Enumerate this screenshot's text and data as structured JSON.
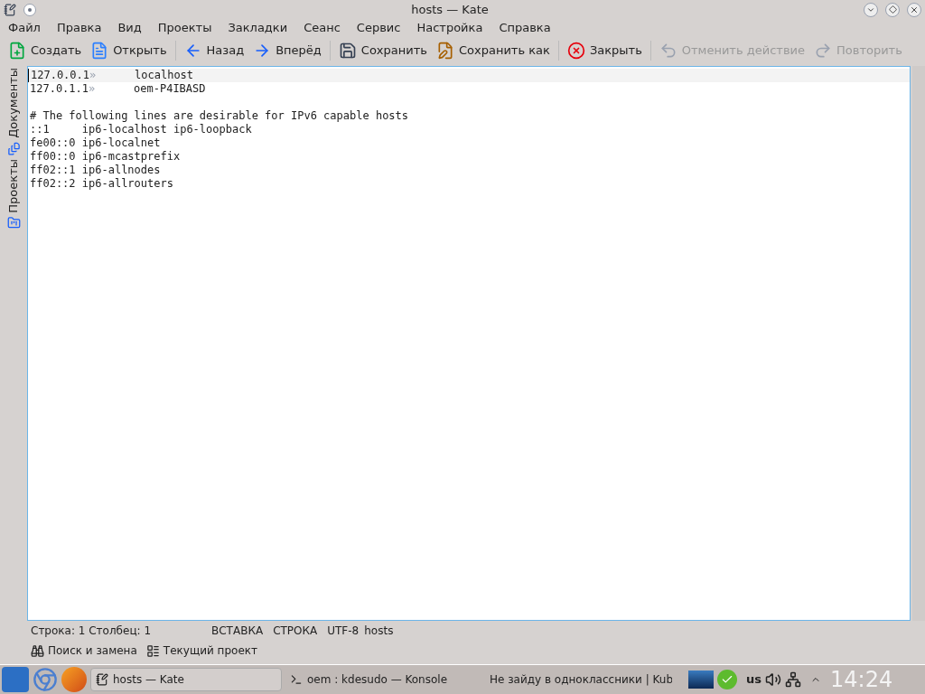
{
  "window": {
    "title": "hosts — Kate"
  },
  "menu": [
    {
      "label": "Файл"
    },
    {
      "label": "Правка"
    },
    {
      "label": "Вид"
    },
    {
      "label": "Проекты"
    },
    {
      "label": "Закладки"
    },
    {
      "label": "Сеанс"
    },
    {
      "label": "Сервис"
    },
    {
      "label": "Настройка"
    },
    {
      "label": "Справка"
    }
  ],
  "toolbar": [
    {
      "kind": "new",
      "label": "Создать",
      "disabled": false
    },
    {
      "kind": "open",
      "label": "Открыть",
      "disabled": false
    },
    {
      "kind": "back",
      "label": "Назад",
      "disabled": false
    },
    {
      "kind": "forward",
      "label": "Вперёд",
      "disabled": false
    },
    {
      "kind": "save",
      "label": "Сохранить",
      "disabled": false
    },
    {
      "kind": "save-as",
      "label": "Сохранить как",
      "disabled": false
    },
    {
      "kind": "close",
      "label": "Закрыть",
      "disabled": false
    },
    {
      "kind": "undo",
      "label": "Отменить действие",
      "disabled": true
    },
    {
      "kind": "redo",
      "label": "Повторить",
      "disabled": true
    }
  ],
  "side_tabs": [
    {
      "label": "Документы",
      "kind": "documents"
    },
    {
      "label": "Проекты",
      "kind": "projects"
    }
  ],
  "editor": {
    "lines": [
      {
        "current": true,
        "segments": [
          {
            "kind": "text",
            "text": "127.0.0.1"
          },
          {
            "kind": "tab",
            "text": "»"
          },
          {
            "kind": "text",
            "text": "localhost"
          }
        ]
      },
      {
        "current": false,
        "segments": [
          {
            "kind": "text",
            "text": "127.0.1.1"
          },
          {
            "kind": "tab",
            "text": "»"
          },
          {
            "kind": "text",
            "text": "oem-P4IBASD"
          }
        ]
      },
      {
        "current": false
      },
      {
        "current": false,
        "segments": [
          {
            "kind": "text",
            "text": "# The following lines are desirable for IPv6 capable hosts"
          }
        ]
      },
      {
        "current": false,
        "segments": [
          {
            "kind": "text",
            "text": "::1     ip6-localhost ip6-loopback"
          }
        ]
      },
      {
        "current": false,
        "segments": [
          {
            "kind": "text",
            "text": "fe00::0 ip6-localnet"
          }
        ]
      },
      {
        "current": false,
        "segments": [
          {
            "kind": "text",
            "text": "ff00::0 ip6-mcastprefix"
          }
        ]
      },
      {
        "current": false,
        "segments": [
          {
            "kind": "text",
            "text": "ff02::1 ip6-allnodes"
          }
        ]
      },
      {
        "current": false,
        "segments": [
          {
            "kind": "text",
            "text": "ff02::2 ip6-allrouters"
          }
        ]
      }
    ]
  },
  "status_bar": {
    "position": "Строка: 1 Столбец: 1",
    "mode": "ВСТАВКА",
    "selection": "СТРОКА",
    "encoding": "UTF-8",
    "file": "hosts"
  },
  "bottom_tabs": [
    {
      "kind": "search",
      "label": "Поиск и замена"
    },
    {
      "kind": "project",
      "label": "Текущий проект"
    }
  ],
  "taskbar": {
    "tasks": [
      {
        "kind": "editor",
        "label": "hosts — Kate",
        "selected": true
      },
      {
        "kind": "terminal",
        "label": "oem : kdesudo — Konsole",
        "selected": false
      },
      {
        "kind": "browser",
        "label": "Не зайду в одноклассники | Kub",
        "selected": false
      }
    ],
    "keyboard_layout": "us",
    "clock": "14:24"
  }
}
